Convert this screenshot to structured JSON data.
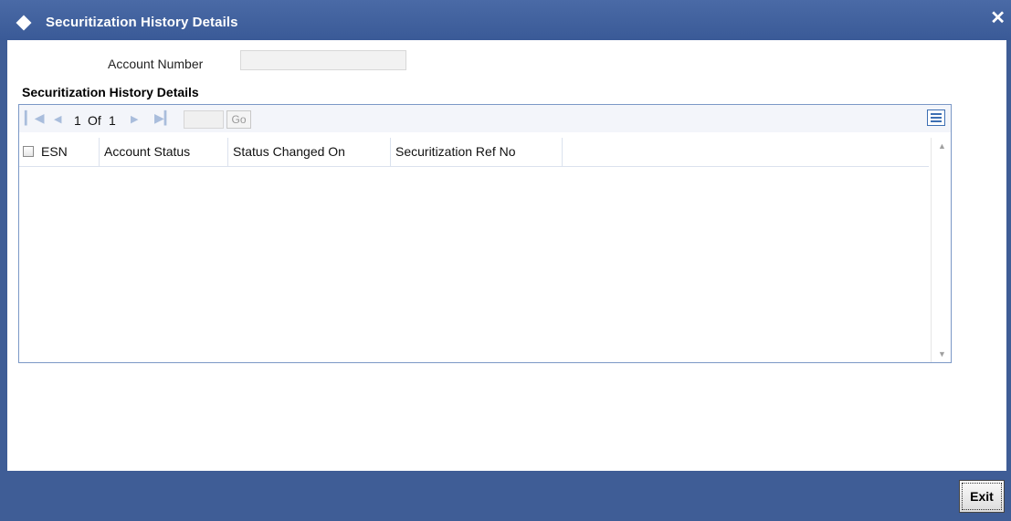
{
  "window": {
    "title": "Securitization History Details",
    "close_symbol": "✕"
  },
  "form": {
    "account_number_label": "Account Number",
    "account_number_value": ""
  },
  "section": {
    "heading": "Securitization History Details"
  },
  "pager": {
    "first_icon": "first-page-icon",
    "prev_icon": "previous-page-icon",
    "next_icon": "next-page-icon",
    "last_icon": "last-page-icon",
    "current_page": "1",
    "of_label": "Of",
    "total_pages": "1",
    "page_input_value": "",
    "go_label": "Go"
  },
  "grid": {
    "columns": [
      "ESN",
      "Account Status",
      "Status Changed On",
      "Securitization Ref No"
    ],
    "rows": []
  },
  "footer": {
    "exit_label": "Exit"
  },
  "colors": {
    "titlebar": "#3f5d96",
    "footer": "#3f5d96",
    "grid_border": "#7b98c6",
    "pager_icons": "#a9bddc"
  }
}
